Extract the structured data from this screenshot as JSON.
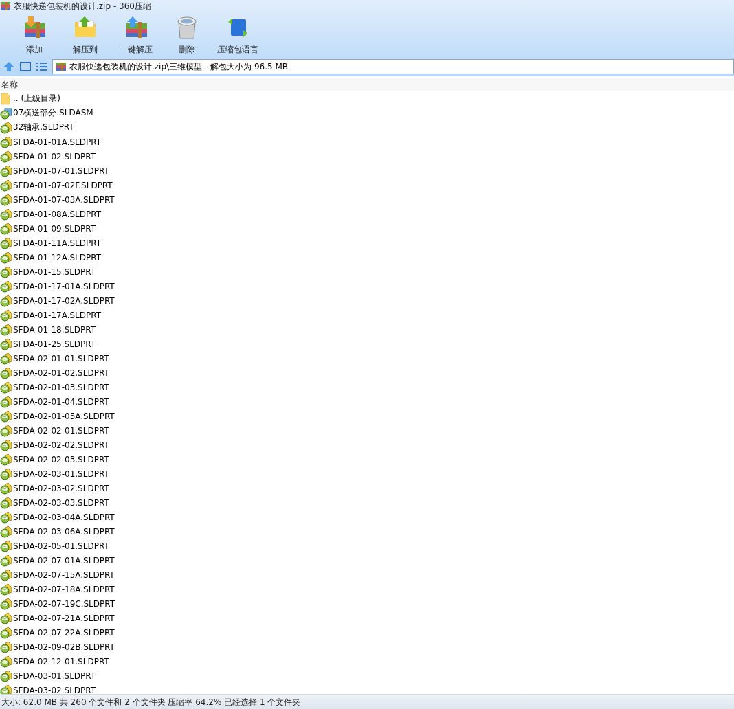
{
  "window": {
    "title": "衣服快递包装机的设计.zip - 360压缩"
  },
  "toolbar": [
    {
      "label": "添加",
      "kind": "add"
    },
    {
      "label": "解压到",
      "kind": "extract"
    },
    {
      "label": "一键解压",
      "kind": "quick"
    },
    {
      "label": "删除",
      "kind": "delete"
    },
    {
      "label": "压缩包语言",
      "kind": "language"
    }
  ],
  "address": {
    "path": "衣服快递包装机的设计.zip\\三维模型 - 解包大小为 96.5 MB"
  },
  "table": {
    "columns": [
      "名称"
    ],
    "rows": [
      {
        "name": ".. (上级目录)",
        "kind": "folder"
      },
      {
        "name": "07横送部分.SLDASM",
        "kind": "assembly"
      },
      {
        "name": "32轴承.SLDPRT",
        "kind": "part"
      },
      {
        "name": "SFDA-01-01A.SLDPRT",
        "kind": "part"
      },
      {
        "name": "SFDA-01-02.SLDPRT",
        "kind": "part"
      },
      {
        "name": "SFDA-01-07-01.SLDPRT",
        "kind": "part"
      },
      {
        "name": "SFDA-01-07-02F.SLDPRT",
        "kind": "part"
      },
      {
        "name": "SFDA-01-07-03A.SLDPRT",
        "kind": "part"
      },
      {
        "name": "SFDA-01-08A.SLDPRT",
        "kind": "part"
      },
      {
        "name": "SFDA-01-09.SLDPRT",
        "kind": "part"
      },
      {
        "name": "SFDA-01-11A.SLDPRT",
        "kind": "part"
      },
      {
        "name": "SFDA-01-12A.SLDPRT",
        "kind": "part"
      },
      {
        "name": "SFDA-01-15.SLDPRT",
        "kind": "part"
      },
      {
        "name": "SFDA-01-17-01A.SLDPRT",
        "kind": "part"
      },
      {
        "name": "SFDA-01-17-02A.SLDPRT",
        "kind": "part"
      },
      {
        "name": "SFDA-01-17A.SLDPRT",
        "kind": "part"
      },
      {
        "name": "SFDA-01-18.SLDPRT",
        "kind": "part"
      },
      {
        "name": "SFDA-01-25.SLDPRT",
        "kind": "part"
      },
      {
        "name": "SFDA-02-01-01.SLDPRT",
        "kind": "part"
      },
      {
        "name": "SFDA-02-01-02.SLDPRT",
        "kind": "part"
      },
      {
        "name": "SFDA-02-01-03.SLDPRT",
        "kind": "part"
      },
      {
        "name": "SFDA-02-01-04.SLDPRT",
        "kind": "part"
      },
      {
        "name": "SFDA-02-01-05A.SLDPRT",
        "kind": "part"
      },
      {
        "name": "SFDA-02-02-01.SLDPRT",
        "kind": "part"
      },
      {
        "name": "SFDA-02-02-02.SLDPRT",
        "kind": "part"
      },
      {
        "name": "SFDA-02-02-03.SLDPRT",
        "kind": "part"
      },
      {
        "name": "SFDA-02-03-01.SLDPRT",
        "kind": "part"
      },
      {
        "name": "SFDA-02-03-02.SLDPRT",
        "kind": "part"
      },
      {
        "name": "SFDA-02-03-03.SLDPRT",
        "kind": "part"
      },
      {
        "name": "SFDA-02-03-04A.SLDPRT",
        "kind": "part"
      },
      {
        "name": "SFDA-02-03-06A.SLDPRT",
        "kind": "part"
      },
      {
        "name": "SFDA-02-05-01.SLDPRT",
        "kind": "part"
      },
      {
        "name": "SFDA-02-07-01A.SLDPRT",
        "kind": "part"
      },
      {
        "name": "SFDA-02-07-15A.SLDPRT",
        "kind": "part"
      },
      {
        "name": "SFDA-02-07-18A.SLDPRT",
        "kind": "part"
      },
      {
        "name": "SFDA-02-07-19C.SLDPRT",
        "kind": "part"
      },
      {
        "name": "SFDA-02-07-21A.SLDPRT",
        "kind": "part"
      },
      {
        "name": "SFDA-02-07-22A.SLDPRT",
        "kind": "part"
      },
      {
        "name": "SFDA-02-09-02B.SLDPRT",
        "kind": "part"
      },
      {
        "name": "SFDA-02-12-01.SLDPRT",
        "kind": "part"
      },
      {
        "name": "SFDA-03-01.SLDPRT",
        "kind": "part"
      },
      {
        "name": "SFDA-03-02.SLDPRT",
        "kind": "part"
      }
    ]
  },
  "status_bar": {
    "text": "大小: 62.0 MB 共 260 个文件和 2 个文件夹 压缩率 64.2% 已经选择 1 个文件夹"
  }
}
